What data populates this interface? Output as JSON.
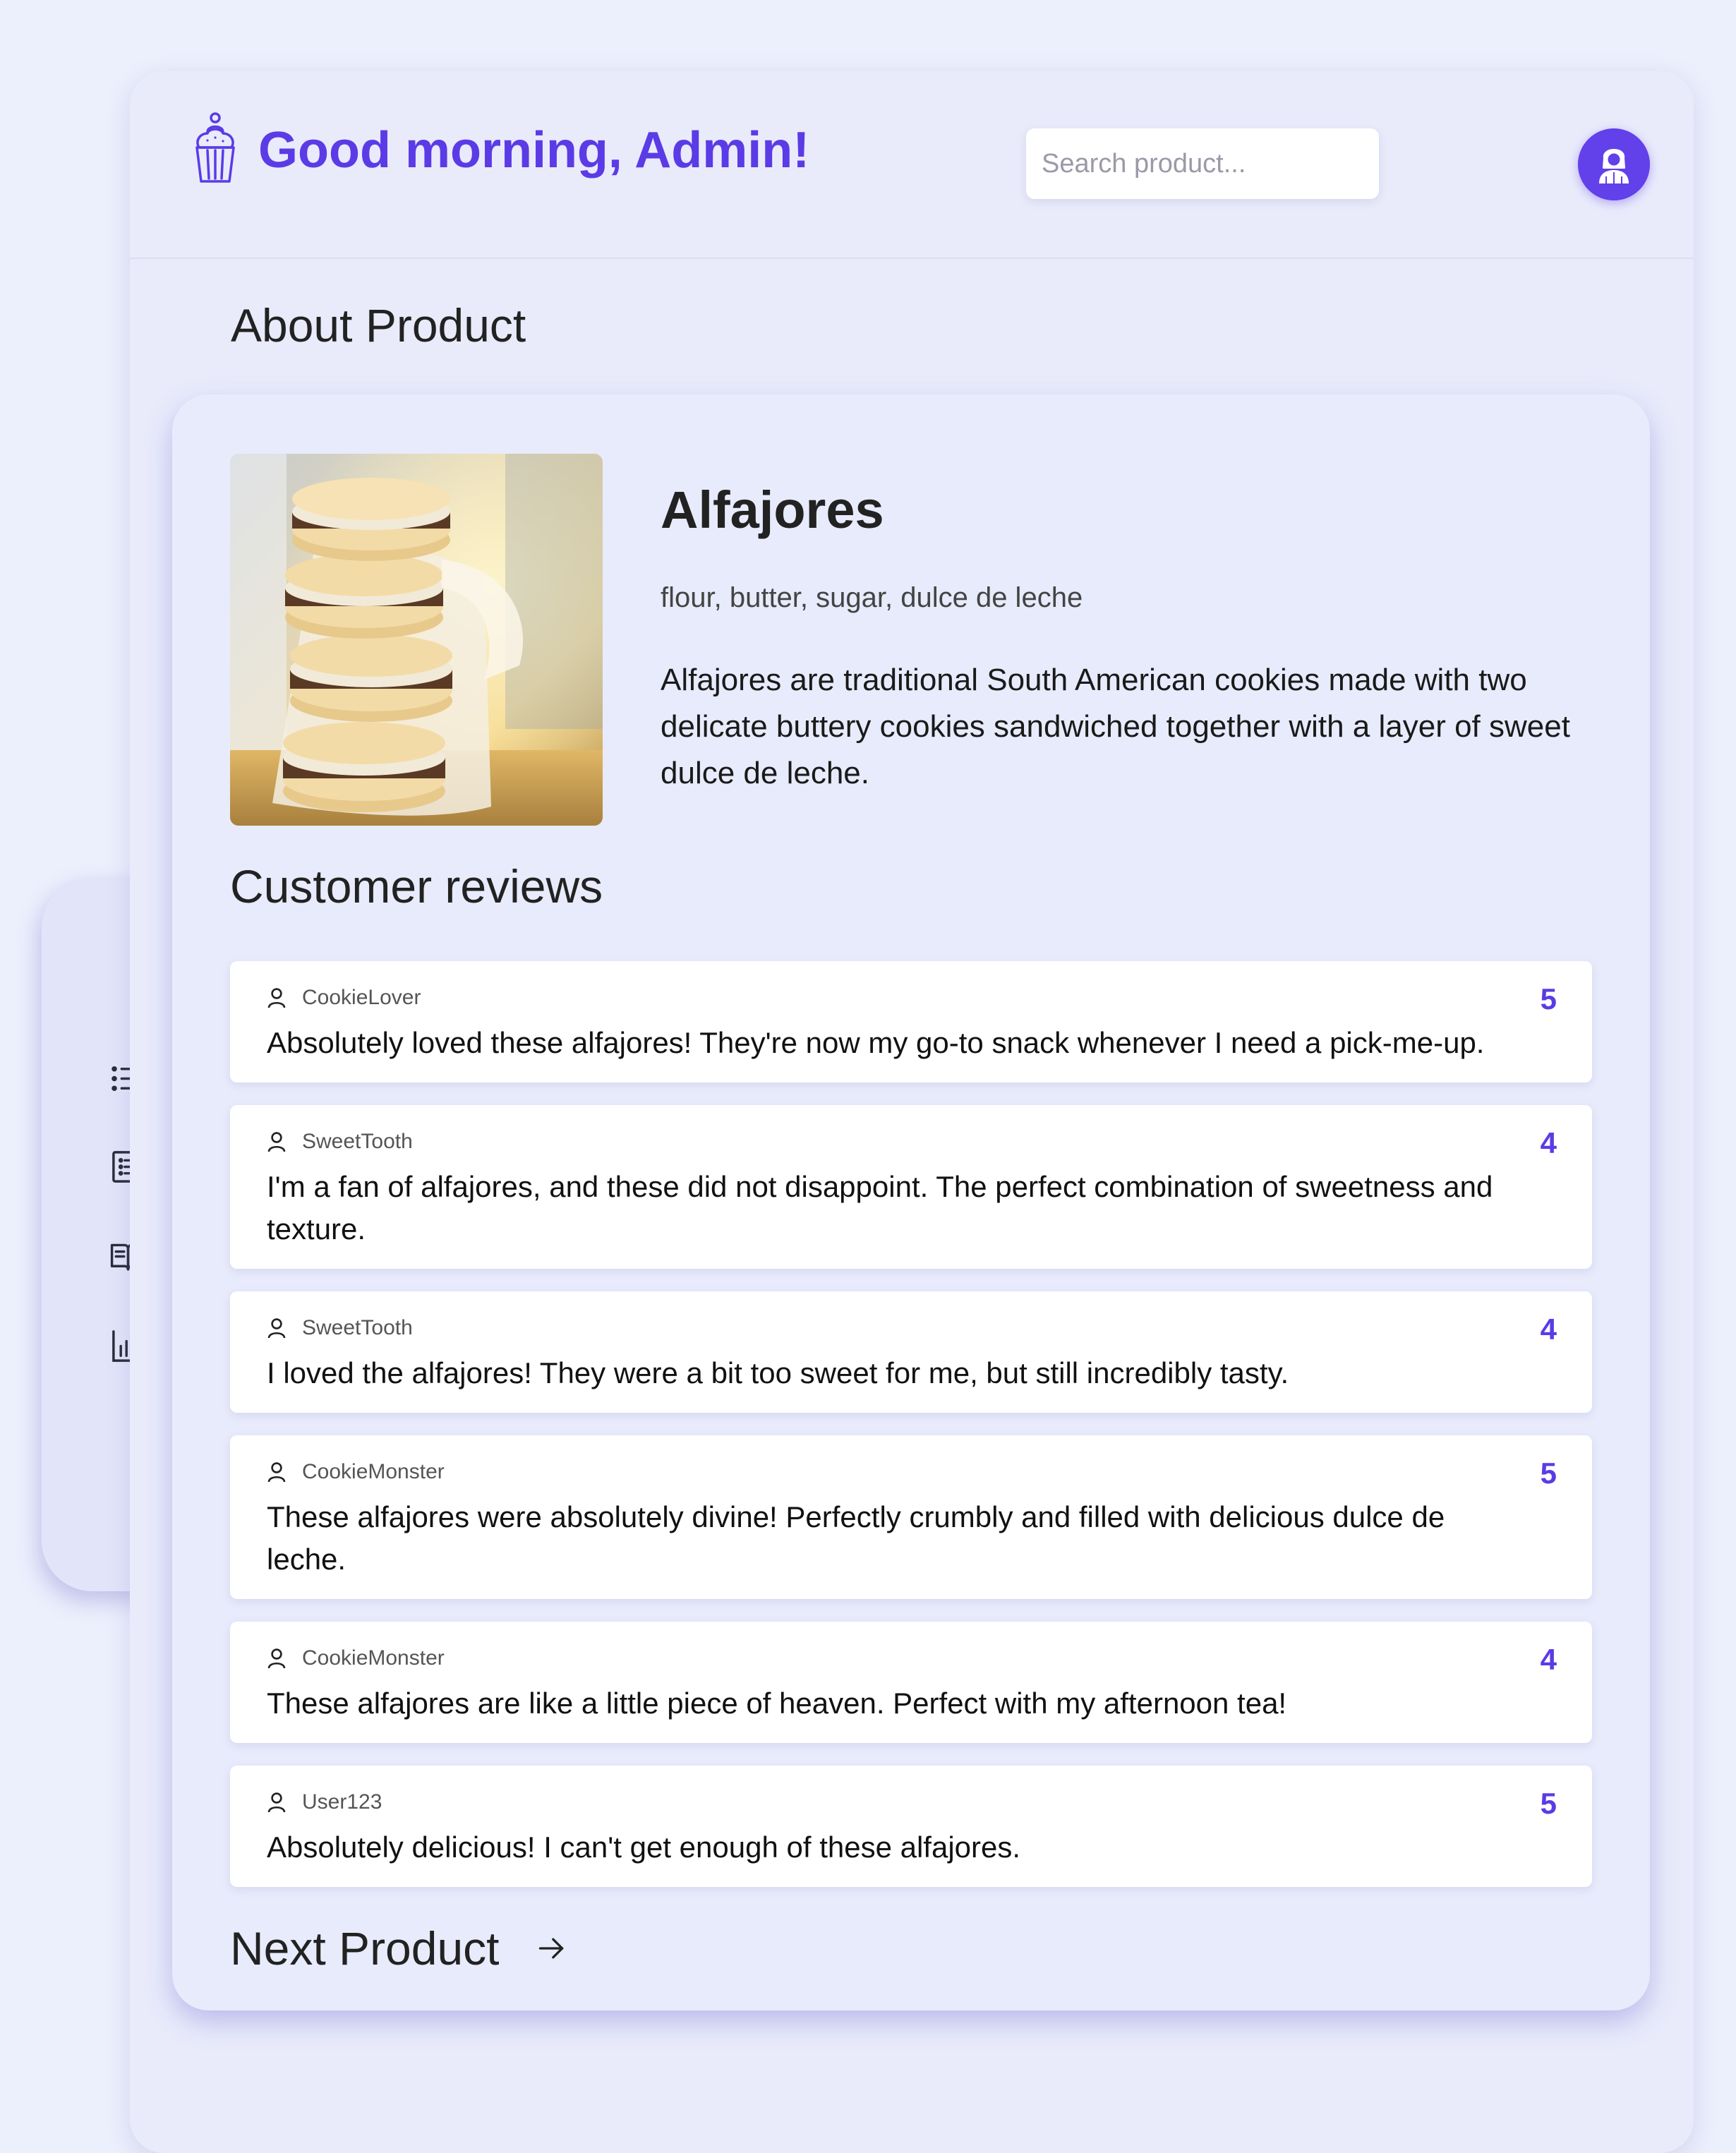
{
  "header": {
    "greeting": "Good morning, Admin!",
    "search_placeholder": "Search product...",
    "logo_icon": "cupcake-icon",
    "avatar_icon": "user-avatar-icon"
  },
  "sidebar": {
    "items": [
      {
        "icon": "list-icon"
      },
      {
        "icon": "checklist-icon"
      },
      {
        "icon": "book-icon"
      },
      {
        "icon": "bar-chart-icon"
      }
    ]
  },
  "about": {
    "title": "About Product"
  },
  "product": {
    "name": "Alfajores",
    "ingredients": "flour, butter, sugar, dulce de leche",
    "description": "Alfajores are traditional South American cookies made with two delicate buttery cookies sandwiched together with a layer of sweet dulce de leche."
  },
  "reviews": {
    "title": "Customer reviews",
    "items": [
      {
        "user": "CookieLover",
        "rating": "5",
        "text": "Absolutely loved these alfajores! They're now my go-to snack whenever I need a pick-me-up."
      },
      {
        "user": "SweetTooth",
        "rating": "4",
        "text": "I'm a fan of alfajores, and these did not disappoint. The perfect combination of sweetness and texture."
      },
      {
        "user": "SweetTooth",
        "rating": "4",
        "text": "I loved the alfajores! They were a bit too sweet for me, but still incredibly tasty."
      },
      {
        "user": "CookieMonster",
        "rating": "5",
        "text": "These alfajores were absolutely divine! Perfectly crumbly and filled with delicious dulce de leche."
      },
      {
        "user": "CookieMonster",
        "rating": "4",
        "text": "These alfajores are like a little piece of heaven. Perfect with my afternoon tea!"
      },
      {
        "user": "User123",
        "rating": "5",
        "text": "Absolutely delicious! I can't get enough of these alfajores."
      }
    ]
  },
  "next": {
    "label": "Next Product",
    "icon": "arrow-right-icon"
  },
  "colors": {
    "accent": "#5b3be6",
    "page_background": "#eceffc",
    "panel_background": "#e9ebfb",
    "card_background": "#ffffff"
  }
}
